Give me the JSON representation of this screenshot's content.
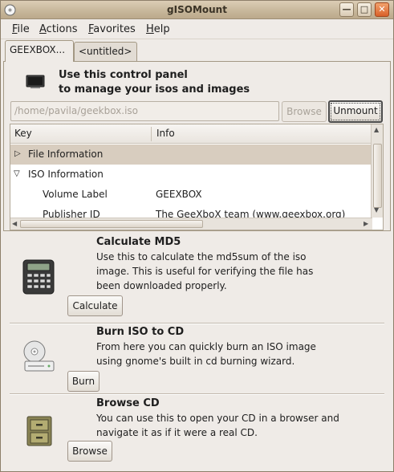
{
  "window": {
    "title": "gISOMount",
    "controls": [
      "minimize",
      "maximize",
      "close"
    ]
  },
  "menubar": {
    "items": [
      {
        "mnemonic": "F",
        "rest": "ile"
      },
      {
        "mnemonic": "A",
        "rest": "ctions"
      },
      {
        "mnemonic": "F",
        "rest": "avorites"
      },
      {
        "mnemonic": "H",
        "rest": "elp"
      }
    ]
  },
  "tabs": [
    {
      "label": "GEEXBOX..."
    },
    {
      "label": "<untitled>"
    }
  ],
  "panel": {
    "line1": "Use this control panel",
    "line2": "to manage your isos and images"
  },
  "path": {
    "value": "/home/pavila/geekbox.iso",
    "browse_label": "Browse",
    "unmount_label": "Unmount"
  },
  "tree": {
    "columns": [
      "Key",
      "Info"
    ],
    "rows": [
      {
        "expander": "collapsed",
        "key": "File Information",
        "info": ""
      },
      {
        "expander": "expanded",
        "key": "ISO Information",
        "info": ""
      },
      {
        "expander": "none",
        "key": "Volume Label",
        "info": "GEEXBOX"
      },
      {
        "expander": "none",
        "key": "Publisher ID",
        "info": "The GeeXboX team (www.geexbox.org)"
      }
    ]
  },
  "sections": [
    {
      "title": "Calculate MD5",
      "desc1": "Use this to calculate the md5sum of the iso",
      "desc2": "image.  This is useful for verifying the file has",
      "desc3": "been downloaded properly.",
      "button": "Calculate",
      "icon": "calculator-icon"
    },
    {
      "title": "Burn ISO to CD",
      "desc1": "From here you can quickly burn an ISO image",
      "desc2": "using gnome's built in cd burning wizard.",
      "desc3": "",
      "button": "Burn",
      "icon": "cd-burner-icon"
    },
    {
      "title": "Browse CD",
      "desc1": "You can use this to open your CD in a browser and",
      "desc2": "navigate it as if it were a real CD.",
      "desc3": "",
      "button": "Browse",
      "icon": "file-cabinet-icon"
    }
  ],
  "colors": {
    "titlebar": "#c8b89c",
    "selected_row": "#d8cdbf",
    "window_bg": "#efebe7"
  }
}
